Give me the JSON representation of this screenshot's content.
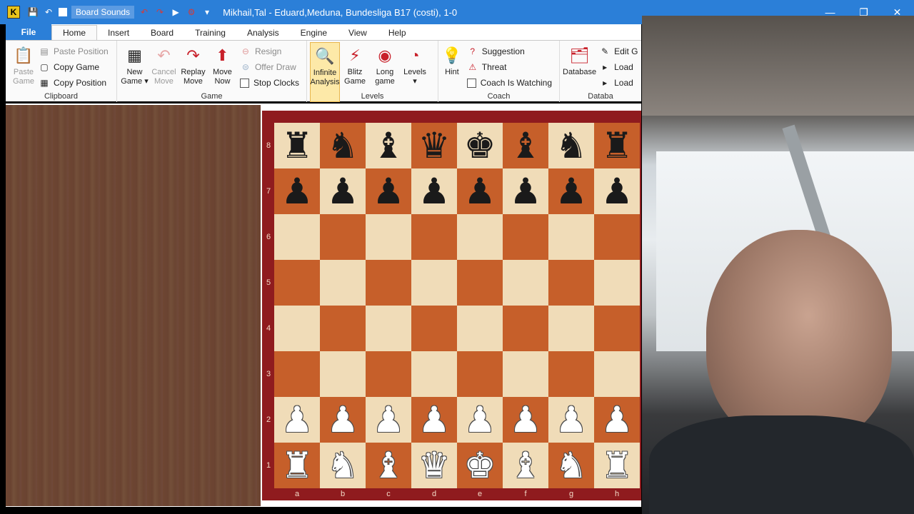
{
  "titlebar": {
    "logo": "K",
    "board_sounds": "Board Sounds",
    "title": "Mikhail,Tal - Eduard,Meduna, Bundesliga  B17  (costi), 1-0",
    "minimize": "—",
    "restore": "❐",
    "close": "✕"
  },
  "ribbon": {
    "tabs": [
      "File",
      "Home",
      "Insert",
      "Board",
      "Training",
      "Analysis",
      "Engine",
      "View",
      "Help"
    ],
    "active_tab": "Home",
    "clipboard": {
      "label": "Clipboard",
      "paste_game": [
        "Paste",
        "Game"
      ],
      "paste_position": "Paste Position",
      "copy_game": "Copy Game",
      "copy_position": "Copy Position"
    },
    "game": {
      "label": "Game",
      "new_game": [
        "New",
        "Game ▾"
      ],
      "cancel_move": [
        "Cancel",
        "Move"
      ],
      "replay_move": [
        "Replay",
        "Move"
      ],
      "move_now": [
        "Move",
        "Now"
      ],
      "resign": "Resign",
      "offer_draw": "Offer Draw",
      "stop_clocks": "Stop Clocks"
    },
    "levels": {
      "label": "Levels",
      "infinite_analysis": [
        "Infinite",
        "Analysis"
      ],
      "blitz_game": [
        "Blitz",
        "Game"
      ],
      "long_game": [
        "Long",
        "game"
      ],
      "levels": [
        "Levels",
        "▾"
      ]
    },
    "coach": {
      "label": "Coach",
      "hint": "Hint",
      "suggestion": "Suggestion",
      "threat": "Threat",
      "coach_watching": "Coach Is Watching"
    },
    "database": {
      "label": "Databa",
      "database": "Database",
      "edit": "Edit G",
      "load1": "Load",
      "load2": "Load"
    }
  },
  "board": {
    "ranks": [
      "8",
      "7",
      "6",
      "5",
      "4",
      "3",
      "2",
      "1"
    ],
    "files": [
      "a",
      "b",
      "c",
      "d",
      "e",
      "f",
      "g",
      "h"
    ],
    "position": [
      [
        "r",
        "n",
        "b",
        "q",
        "k",
        "b",
        "n",
        "r"
      ],
      [
        "p",
        "p",
        "p",
        "p",
        "p",
        "p",
        "p",
        "p"
      ],
      [
        "",
        "",
        "",
        "",
        "",
        "",
        "",
        ""
      ],
      [
        "",
        "",
        "",
        "",
        "",
        "",
        "",
        ""
      ],
      [
        "",
        "",
        "",
        "",
        "",
        "",
        "",
        ""
      ],
      [
        "",
        "",
        "",
        "",
        "",
        "",
        "",
        ""
      ],
      [
        "P",
        "P",
        "P",
        "P",
        "P",
        "P",
        "P",
        "P"
      ],
      [
        "R",
        "N",
        "B",
        "Q",
        "K",
        "B",
        "N",
        "R"
      ]
    ]
  },
  "colors": {
    "accent": "#2b7fd8",
    "light_square": "#f0dcb8",
    "dark_square": "#c65f2a",
    "board_frame": "#8f1b1e"
  }
}
